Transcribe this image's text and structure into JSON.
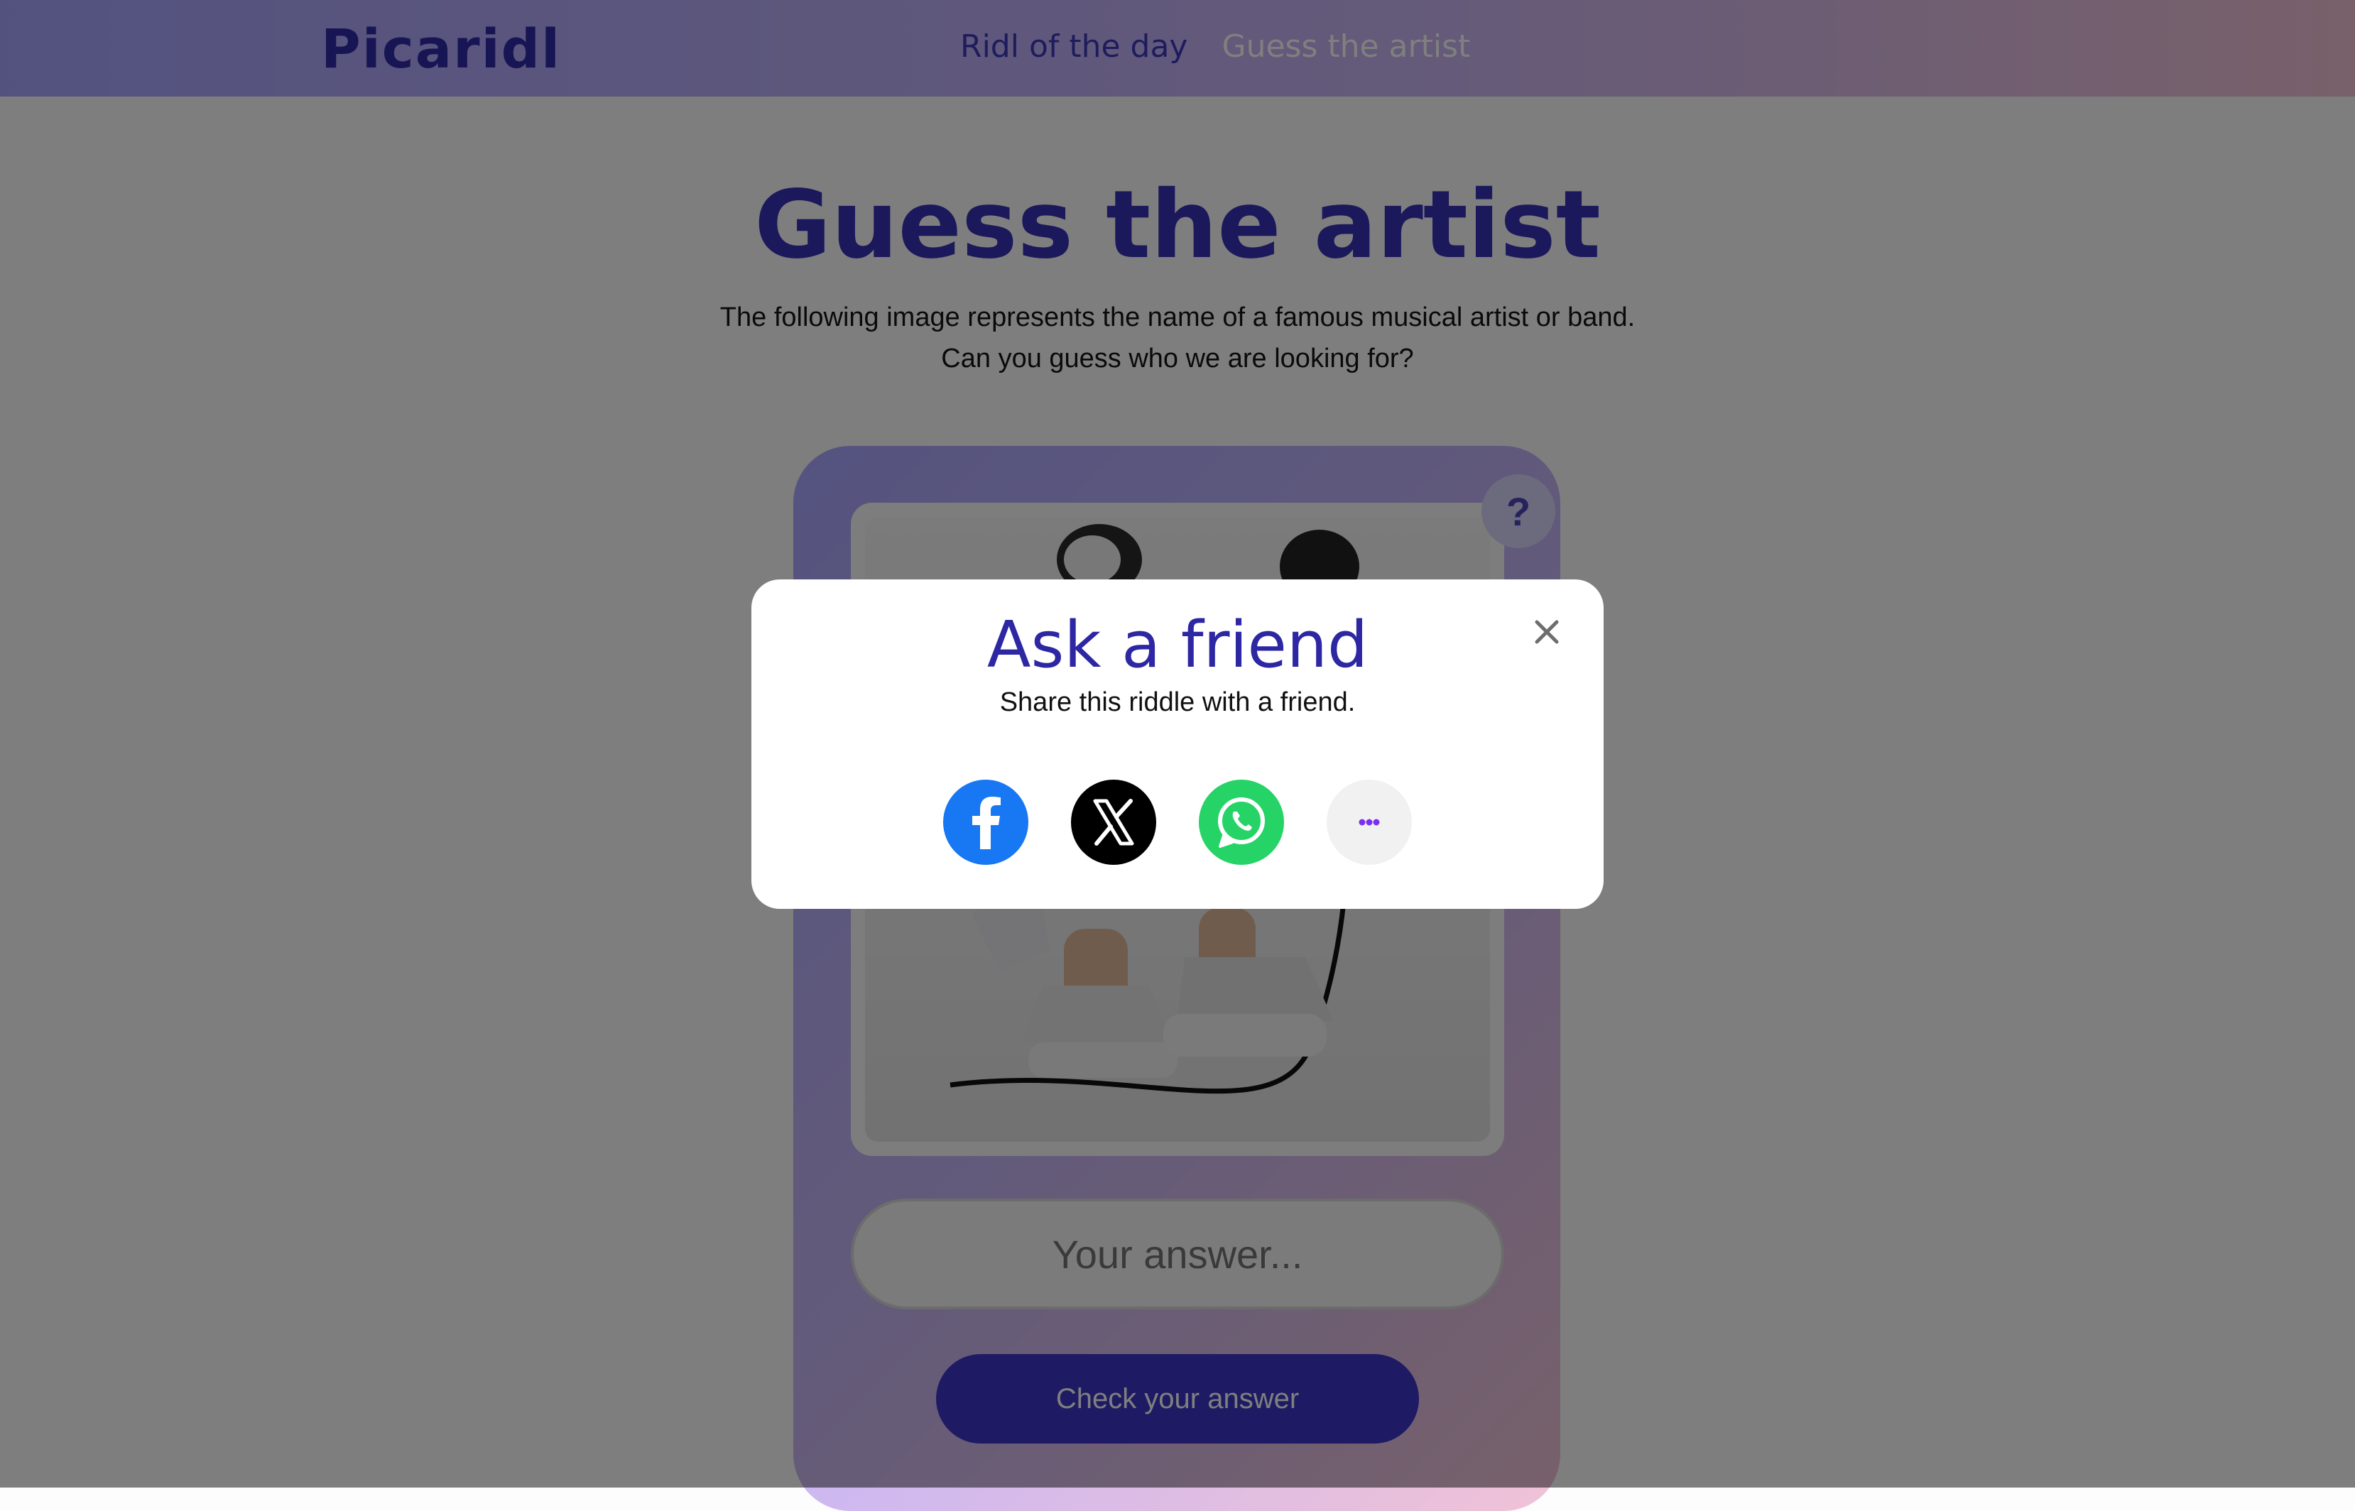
{
  "header": {
    "logo": "Picaridl",
    "nav": [
      {
        "label": "Ridl of the day"
      },
      {
        "label": "Guess the artist"
      }
    ]
  },
  "main": {
    "title": "Guess the artist",
    "subtitle_line1": "The following image represents the name of a famous musical artist or band.",
    "subtitle_line2": "Can you guess who we are looking for?",
    "help_label": "?",
    "answer_placeholder": "Your answer...",
    "check_label": "Check your answer"
  },
  "modal": {
    "title": "Ask a friend",
    "text": "Share this riddle with a friend.",
    "share": [
      {
        "icon": "facebook-icon",
        "color": "#1877F2"
      },
      {
        "icon": "x-icon",
        "color": "#000000"
      },
      {
        "icon": "whatsapp-icon",
        "color": "#25D366"
      },
      {
        "icon": "more-icon",
        "color": "#F1F1F1"
      }
    ]
  },
  "colors": {
    "accent": "#3D37C8",
    "title": "#3730B9"
  }
}
